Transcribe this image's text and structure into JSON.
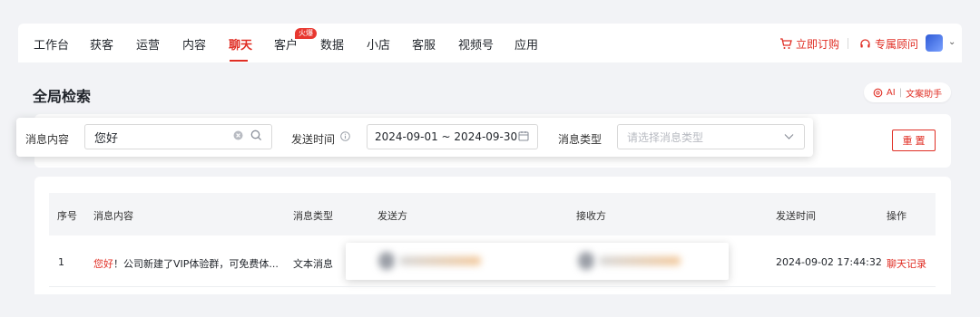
{
  "nav": {
    "items": [
      "工作台",
      "获客",
      "运营",
      "内容",
      "聊天",
      "客户",
      "数据",
      "小店",
      "客服",
      "视频号",
      "应用"
    ],
    "active": "聊天",
    "hot_badge": "火爆",
    "order_label": "立即订购",
    "consultant_label": "专属顾问"
  },
  "page": {
    "title": "全局检索",
    "ai_label": "AI",
    "ai_helper_label": "文案助手"
  },
  "filters": {
    "content_label": "消息内容",
    "content_value": "您好",
    "time_label": "发送时间",
    "time_value": "2024-09-01 ~ 2024-09-30",
    "type_label": "消息类型",
    "type_placeholder": "请选择消息类型",
    "reset_label": "重 置"
  },
  "table": {
    "headers": [
      "序号",
      "消息内容",
      "消息类型",
      "发送方",
      "接收方",
      "发送时间",
      "操作"
    ],
    "rows": [
      {
        "index": "1",
        "content_highlight": "您好",
        "content_rest": "！公司新建了VIP体验群，可免费体...",
        "type": "文本消息",
        "time": "2024-09-02 17:44:32",
        "action": "聊天记录"
      }
    ]
  },
  "colors": {
    "accent": "#e02e24"
  }
}
